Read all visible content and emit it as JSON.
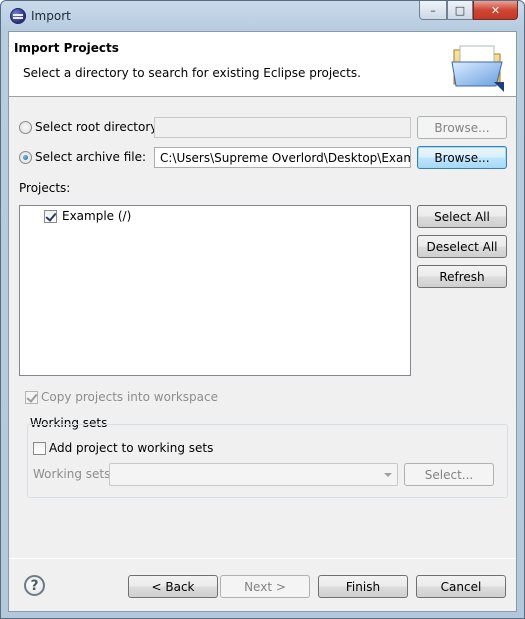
{
  "window": {
    "title": "Import",
    "controls": {
      "minimize": "–",
      "maximize": "□",
      "close": "✕"
    }
  },
  "header": {
    "title": "Import Projects",
    "description": "Select a directory to search for existing Eclipse projects.",
    "icon": "folder-wizard-icon"
  },
  "source": {
    "root_directory_label": "Select root directory:",
    "root_directory_value": "",
    "root_browse_label": "Browse...",
    "archive_file_label": "Select archive file:",
    "archive_file_value": "C:\\Users\\Supreme Overlord\\Desktop\\Example.jar",
    "archive_browse_label": "Browse...",
    "selected_option": "archive"
  },
  "projects": {
    "label": "Projects:",
    "items": [
      {
        "label": "Example (/)",
        "checked": true
      }
    ],
    "select_all_label": "Select All",
    "deselect_all_label": "Deselect All",
    "refresh_label": "Refresh"
  },
  "copy_into_workspace": {
    "label": "Copy projects into workspace",
    "checked": true,
    "enabled": false
  },
  "working_sets": {
    "group_label": "Working sets",
    "add_label": "Add project to working sets",
    "add_checked": false,
    "field_label": "Working sets:",
    "value": "",
    "select_label": "Select..."
  },
  "footer": {
    "back_label": "< Back",
    "next_label": "Next >",
    "finish_label": "Finish",
    "cancel_label": "Cancel"
  }
}
